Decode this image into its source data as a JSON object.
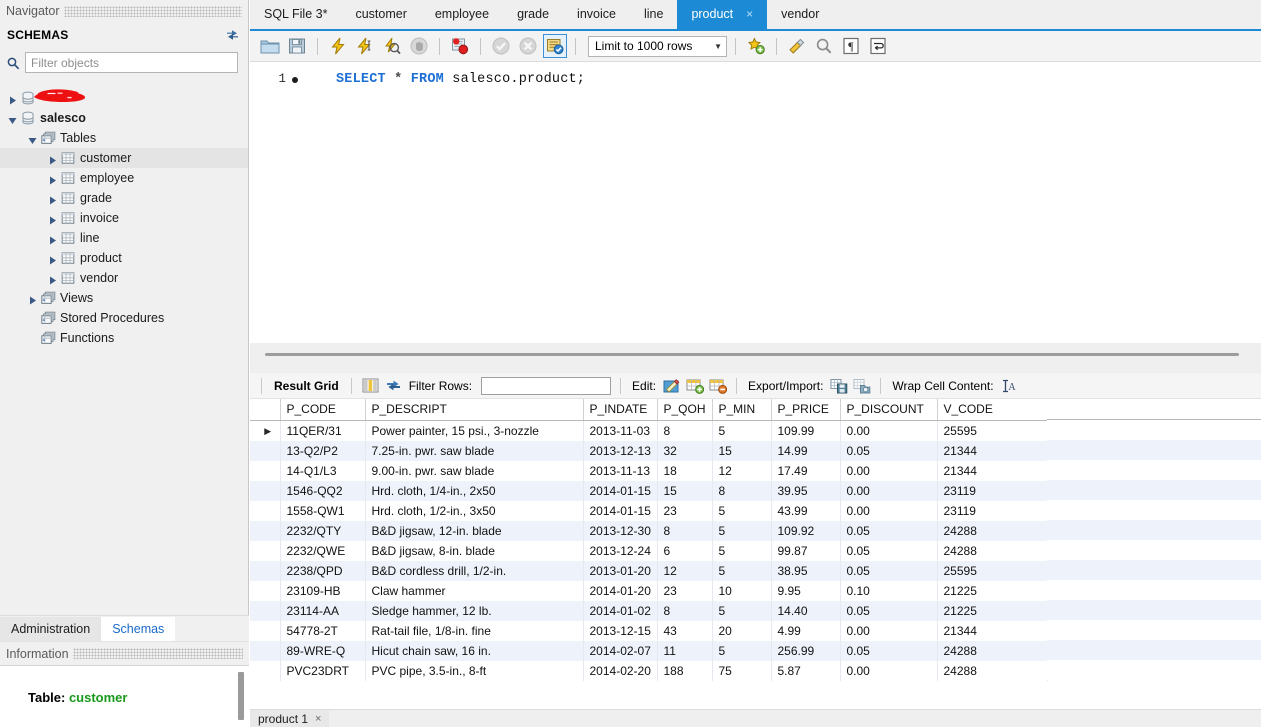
{
  "navigator": {
    "caption": "Navigator",
    "schemas_title": "SCHEMAS",
    "refresh_icon": "refresh-icon",
    "filter_placeholder": "Filter objects",
    "search_icon": "search-icon",
    "tree": [
      {
        "label": "",
        "type": "schema",
        "depth": 0,
        "arrow": "collapsed",
        "redacted": true,
        "bold": true
      },
      {
        "label": "salesco",
        "type": "schema",
        "depth": 0,
        "arrow": "expanded",
        "bold": true
      },
      {
        "label": "Tables",
        "type": "folder",
        "depth": 1,
        "arrow": "expanded"
      },
      {
        "label": "customer",
        "type": "table",
        "depth": 2,
        "arrow": "collapsed",
        "selected": true
      },
      {
        "label": "employee",
        "type": "table",
        "depth": 2,
        "arrow": "collapsed"
      },
      {
        "label": "grade",
        "type": "table",
        "depth": 2,
        "arrow": "collapsed"
      },
      {
        "label": "invoice",
        "type": "table",
        "depth": 2,
        "arrow": "collapsed"
      },
      {
        "label": "line",
        "type": "table",
        "depth": 2,
        "arrow": "collapsed"
      },
      {
        "label": "product",
        "type": "table",
        "depth": 2,
        "arrow": "collapsed"
      },
      {
        "label": "vendor",
        "type": "table",
        "depth": 2,
        "arrow": "collapsed"
      },
      {
        "label": "Views",
        "type": "folder",
        "depth": 1,
        "arrow": "collapsed"
      },
      {
        "label": "Stored Procedures",
        "type": "folder",
        "depth": 1,
        "arrow": "none"
      },
      {
        "label": "Functions",
        "type": "folder",
        "depth": 1,
        "arrow": "none"
      }
    ],
    "bottom_tabs": [
      {
        "label": "Administration",
        "active": false
      },
      {
        "label": "Schemas",
        "active": true
      }
    ],
    "information_caption": "Information",
    "info": {
      "key": "Table:",
      "value": "customer"
    }
  },
  "editor_tabs": [
    {
      "label": "SQL File 3*",
      "active": false,
      "closable": false
    },
    {
      "label": "customer",
      "active": false,
      "closable": false
    },
    {
      "label": "employee",
      "active": false,
      "closable": false
    },
    {
      "label": "grade",
      "active": false,
      "closable": false
    },
    {
      "label": "invoice",
      "active": false,
      "closable": false
    },
    {
      "label": "line",
      "active": false,
      "closable": false
    },
    {
      "label": "product",
      "active": true,
      "closable": true,
      "close_icon": "close-icon"
    },
    {
      "label": "vendor",
      "active": false,
      "closable": false
    }
  ],
  "toolbar": {
    "icons": [
      "open-file-icon",
      "save-file-icon",
      "execute-statement-icon",
      "execute-current-statement-icon",
      "explain-statement-icon",
      "stop-execution-icon",
      "toggle-breakpoint-icon",
      "commit-transaction-icon",
      "rollback-transaction-icon",
      "toggle-autocommit-icon"
    ],
    "limit_label": "Limit to 1000 rows",
    "chevron": "▼",
    "right_icons": [
      "snippets-icon",
      "beautify-sql-icon",
      "find-icon",
      "show-invisible-chars-icon",
      "wrap-lines-icon"
    ]
  },
  "editor": {
    "line_number": "1",
    "breakpoint_marker": "statement-marker",
    "sql": {
      "kw1": "SELECT",
      "star": "*",
      "kw2": "FROM",
      "target": "salesco.product;"
    }
  },
  "result_toolbar": {
    "title": "Result Grid",
    "grid_view_icon": "grid-view-icon",
    "refresh_icon": "refresh-grid-icon",
    "filter_label": "Filter Rows:",
    "filter_value": "",
    "filter_placeholder": "",
    "edit_label": "Edit:",
    "edit_icons": [
      "edit-cell-icon",
      "insert-row-icon",
      "delete-row-icon"
    ],
    "export_label": "Export/Import:",
    "export_icons": [
      "export-recordset-icon",
      "import-recordset-icon"
    ],
    "wrap_label": "Wrap Cell Content:",
    "wrap_icon": "wrap-cell-content-icon"
  },
  "grid": {
    "columns": [
      "P_CODE",
      "P_DESCRIPT",
      "P_INDATE",
      "P_QOH",
      "P_MIN",
      "P_PRICE",
      "P_DISCOUNT",
      "V_CODE"
    ],
    "current_row_marker": "▶",
    "rows": [
      [
        "11QER/31",
        "Power painter, 15 psi., 3-nozzle",
        "2013-11-03",
        "8",
        "5",
        "109.99",
        "0.00",
        "25595"
      ],
      [
        "13-Q2/P2",
        "7.25-in. pwr. saw blade",
        "2013-12-13",
        "32",
        "15",
        "14.99",
        "0.05",
        "21344"
      ],
      [
        "14-Q1/L3",
        "9.00-in. pwr. saw blade",
        "2013-11-13",
        "18",
        "12",
        "17.49",
        "0.00",
        "21344"
      ],
      [
        "1546-QQ2",
        "Hrd. cloth, 1/4-in., 2x50",
        "2014-01-15",
        "15",
        "8",
        "39.95",
        "0.00",
        "23119"
      ],
      [
        "1558-QW1",
        "Hrd. cloth, 1/2-in., 3x50",
        "2014-01-15",
        "23",
        "5",
        "43.99",
        "0.00",
        "23119"
      ],
      [
        "2232/QTY",
        "B&D jigsaw, 12-in. blade",
        "2013-12-30",
        "8",
        "5",
        "109.92",
        "0.05",
        "24288"
      ],
      [
        "2232/QWE",
        "B&D jigsaw, 8-in. blade",
        "2013-12-24",
        "6",
        "5",
        "99.87",
        "0.05",
        "24288"
      ],
      [
        "2238/QPD",
        "B&D cordless drill, 1/2-in.",
        "2013-01-20",
        "12",
        "5",
        "38.95",
        "0.05",
        "25595"
      ],
      [
        "23109-HB",
        "Claw hammer",
        "2014-01-20",
        "23",
        "10",
        "9.95",
        "0.10",
        "21225"
      ],
      [
        "23114-AA",
        "Sledge hammer, 12 lb.",
        "2014-01-02",
        "8",
        "5",
        "14.40",
        "0.05",
        "21225"
      ],
      [
        "54778-2T",
        "Rat-tail file, 1/8-in. fine",
        "2013-12-15",
        "43",
        "20",
        "4.99",
        "0.00",
        "21344"
      ],
      [
        "89-WRE-Q",
        "Hicut chain saw, 16 in.",
        "2014-02-07",
        "11",
        "5",
        "256.99",
        "0.05",
        "24288"
      ],
      [
        "PVC23DRT",
        "PVC pipe, 3.5-in., 8-ft",
        "2014-02-20",
        "188",
        "75",
        "5.87",
        "0.00",
        "24288"
      ]
    ]
  },
  "result_tabs": [
    {
      "label": "product 1",
      "close_icon": "close-icon"
    }
  ],
  "colors": {
    "accent": "#1d8ad6",
    "keyword": "#1d6fd4",
    "alt_row": "#eef3fb",
    "green_value": "#1a9a1a",
    "redaction": "#ee1111"
  }
}
